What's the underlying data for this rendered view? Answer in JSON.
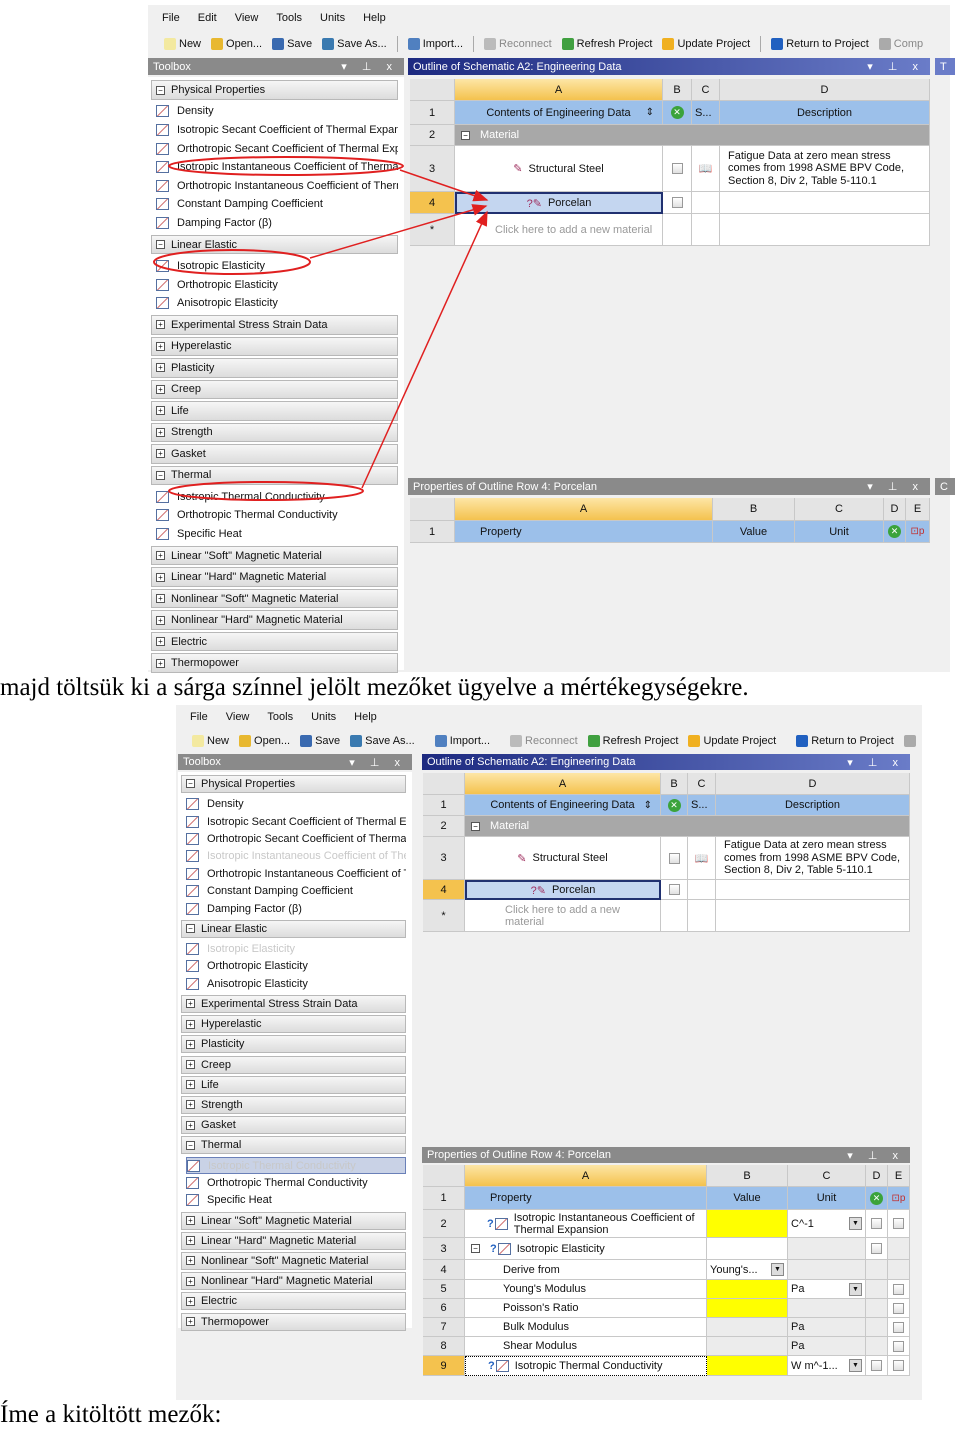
{
  "captions": {
    "middle": "majd töltsük ki a sárga színnel jelölt mezőket ügyelve a mértékegységekre.",
    "bottom": "Íme a kitöltött mezők:"
  },
  "colors": {
    "panel_header": "#2b3a8c",
    "toolbox_header": "#8a8a8a",
    "selected_row": "#f4c24e",
    "required_field": "#ffff00",
    "annotation": "#e02020"
  },
  "shot1": {
    "menu": [
      "File",
      "Edit",
      "View",
      "Tools",
      "Units",
      "Help"
    ],
    "toolbar": [
      {
        "label": "New",
        "icon": "new-icon"
      },
      {
        "label": "Open...",
        "icon": "open-icon"
      },
      {
        "label": "Save",
        "icon": "save-icon"
      },
      {
        "label": "Save As...",
        "icon": "save-as-icon"
      },
      {
        "label": "Import...",
        "icon": "import-icon",
        "sep": true
      },
      {
        "label": "Reconnect",
        "icon": "reconnect-icon",
        "disabled": true,
        "sep": true
      },
      {
        "label": "Refresh Project",
        "icon": "refresh-icon"
      },
      {
        "label": "Update Project",
        "icon": "lightning-icon"
      },
      {
        "label": "Return to Project",
        "icon": "back-arrow-icon",
        "sep": true
      },
      {
        "label": "Comp",
        "icon": "compact-icon",
        "disabled": true
      }
    ],
    "toolbox_title": "Toolbox",
    "outline_title": "Outline of Schematic A2: Engineering Data",
    "right_tab": "T",
    "props_title": "Properties of Outline Row 4: Porcelan",
    "props_right_tab": "C"
  },
  "shot2": {
    "menu": [
      "File",
      "View",
      "Tools",
      "Units",
      "Help"
    ],
    "toolbar": [
      {
        "label": "New",
        "icon": "new-icon"
      },
      {
        "label": "Open...",
        "icon": "open-icon"
      },
      {
        "label": "Save",
        "icon": "save-icon"
      },
      {
        "label": "Save As...",
        "icon": "save-as-icon"
      },
      {
        "label": "Import...",
        "icon": "import-icon",
        "sep": true
      },
      {
        "label": "Reconnect",
        "icon": "reconnect-icon",
        "disabled": true,
        "sep": true
      },
      {
        "label": "Refresh Project",
        "icon": "refresh-icon"
      },
      {
        "label": "Update Project",
        "icon": "lightning-icon"
      },
      {
        "label": "Return to Project",
        "icon": "back-arrow-icon",
        "sep": true
      },
      {
        "label": "Com",
        "icon": "compact-icon",
        "disabled": true
      }
    ],
    "toolbox_title": "Toolbox",
    "outline_title": "Outline of Schematic A2: Engineering Data",
    "props_title": "Properties of Outline Row 4: Porcelan"
  },
  "toolbox": [
    {
      "label": "Physical Properties",
      "type": "group",
      "expanded": true
    },
    {
      "label": "Density",
      "type": "item"
    },
    {
      "label": "Isotropic Secant Coefficient of Thermal Expansion",
      "type": "item"
    },
    {
      "label": "Orthotropic Secant Coefficient of Thermal Expansion",
      "type": "item"
    },
    {
      "label": "Isotropic Instantaneous Coefficient of Thermal Expansion",
      "type": "item",
      "used": true
    },
    {
      "label": "Orthotropic Instantaneous Coefficient of Thermal Expansion",
      "type": "item"
    },
    {
      "label": "Constant Damping Coefficient",
      "type": "item"
    },
    {
      "label": "Damping Factor (β)",
      "type": "item"
    },
    {
      "label": "Linear Elastic",
      "type": "group",
      "expanded": true
    },
    {
      "label": "Isotropic Elasticity",
      "type": "item",
      "used": true
    },
    {
      "label": "Orthotropic Elasticity",
      "type": "item"
    },
    {
      "label": "Anisotropic Elasticity",
      "type": "item"
    },
    {
      "label": "Experimental Stress Strain Data",
      "type": "group"
    },
    {
      "label": "Hyperelastic",
      "type": "group"
    },
    {
      "label": "Plasticity",
      "type": "group"
    },
    {
      "label": "Creep",
      "type": "group"
    },
    {
      "label": "Life",
      "type": "group"
    },
    {
      "label": "Strength",
      "type": "group"
    },
    {
      "label": "Gasket",
      "type": "group"
    },
    {
      "label": "Thermal",
      "type": "group",
      "expanded": true
    },
    {
      "label": "Isotropic Thermal Conductivity",
      "type": "item",
      "used": true
    },
    {
      "label": "Orthotropic Thermal Conductivity",
      "type": "item"
    },
    {
      "label": "Specific Heat",
      "type": "item"
    },
    {
      "label": "Linear \"Soft\" Magnetic Material",
      "type": "group"
    },
    {
      "label": "Linear \"Hard\" Magnetic Material",
      "type": "group"
    },
    {
      "label": "Nonlinear \"Soft\" Magnetic Material",
      "type": "group"
    },
    {
      "label": "Nonlinear \"Hard\" Magnetic Material",
      "type": "group"
    },
    {
      "label": "Electric",
      "type": "group"
    },
    {
      "label": "Thermopower",
      "type": "group"
    }
  ],
  "outline": {
    "columns": [
      "A",
      "B",
      "C",
      "D"
    ],
    "rows": [
      {
        "num": "1",
        "a": "Contents of Engineering Data",
        "c": "S...",
        "d": "Description",
        "kind": "header"
      },
      {
        "num": "2",
        "a": "Material",
        "kind": "section"
      },
      {
        "num": "3",
        "a": "Structural Steel",
        "d": "Fatigue Data at zero mean stress comes from 1998 ASME BPV Code, Section 8, Div 2, Table 5-110.1",
        "kind": "material"
      },
      {
        "num": "4",
        "a": "Porcelan",
        "kind": "selected"
      },
      {
        "num": "*",
        "a": "Click here to add a new material",
        "kind": "new"
      }
    ]
  },
  "props1": {
    "columns": [
      "A",
      "B",
      "C",
      "D",
      "E"
    ],
    "rows": [
      {
        "num": "1",
        "a": "Property",
        "b": "Value",
        "c": "Unit",
        "kind": "header"
      }
    ]
  },
  "props2": {
    "columns": [
      "A",
      "B",
      "C",
      "D",
      "E"
    ],
    "rows": [
      {
        "num": "1",
        "a": "Property",
        "b": "Value",
        "c": "Unit",
        "kind": "header"
      },
      {
        "num": "2",
        "a": "Isotropic Instantaneous Coefficient of Thermal Expansion",
        "c": "C^-1",
        "kind": "prop",
        "yellow": true,
        "dd": true,
        "d": true,
        "e": true
      },
      {
        "num": "3",
        "a": "Isotropic Elasticity",
        "kind": "propgroup",
        "d": true
      },
      {
        "num": "4",
        "a": "Derive from",
        "b": "Young's...",
        "kind": "sub",
        "bdd": true
      },
      {
        "num": "5",
        "a": "Young's Modulus",
        "c": "Pa",
        "kind": "sub",
        "yellow": true,
        "dd": true,
        "e": true
      },
      {
        "num": "6",
        "a": "Poisson's Ratio",
        "kind": "sub",
        "yellow": true,
        "e": true
      },
      {
        "num": "7",
        "a": "Bulk Modulus",
        "c": "Pa",
        "kind": "sub",
        "greyb": true,
        "e": true
      },
      {
        "num": "8",
        "a": "Shear Modulus",
        "c": "Pa",
        "kind": "sub",
        "greyb": true,
        "e": true
      },
      {
        "num": "9",
        "a": "Isotropic Thermal Conductivity",
        "c": "W m^-1...",
        "kind": "prop",
        "yellow": true,
        "dd": true,
        "d": true,
        "e": true,
        "selected": true
      }
    ]
  }
}
